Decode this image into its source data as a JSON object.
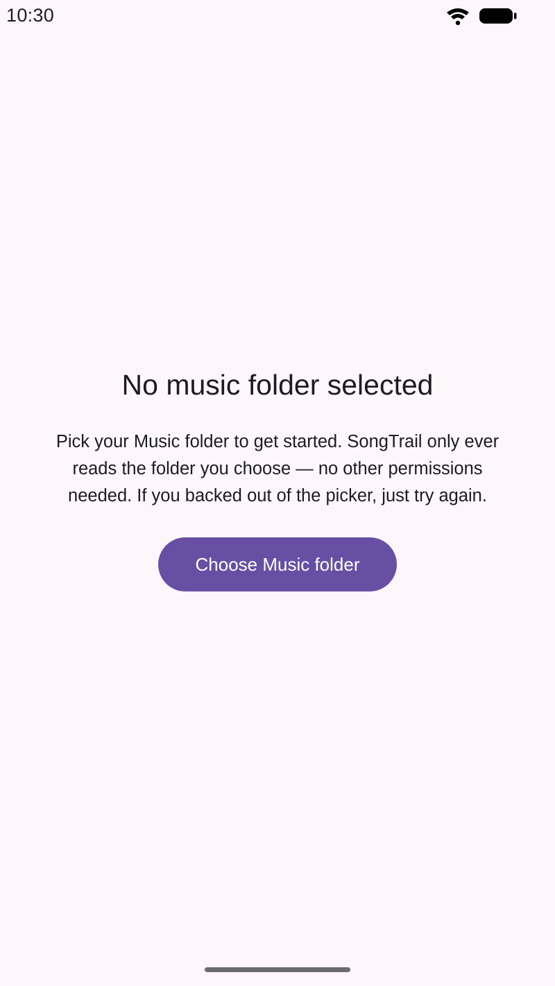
{
  "status_bar": {
    "time": "10:30",
    "icons": [
      "wifi-icon",
      "battery-icon"
    ]
  },
  "empty_state": {
    "title": "No music folder selected",
    "message": "Pick your Music folder to get started. SongTrail only ever reads the folder you choose — no other permissions needed. If you backed out of the picker, just try again.",
    "button_label": "Choose Music folder"
  },
  "colors": {
    "background": "#fdf7fc",
    "accent": "#6750a4",
    "text": "#1c1b1f",
    "on_accent": "#ffffff",
    "gesture_bar": "#6b6a6f"
  }
}
